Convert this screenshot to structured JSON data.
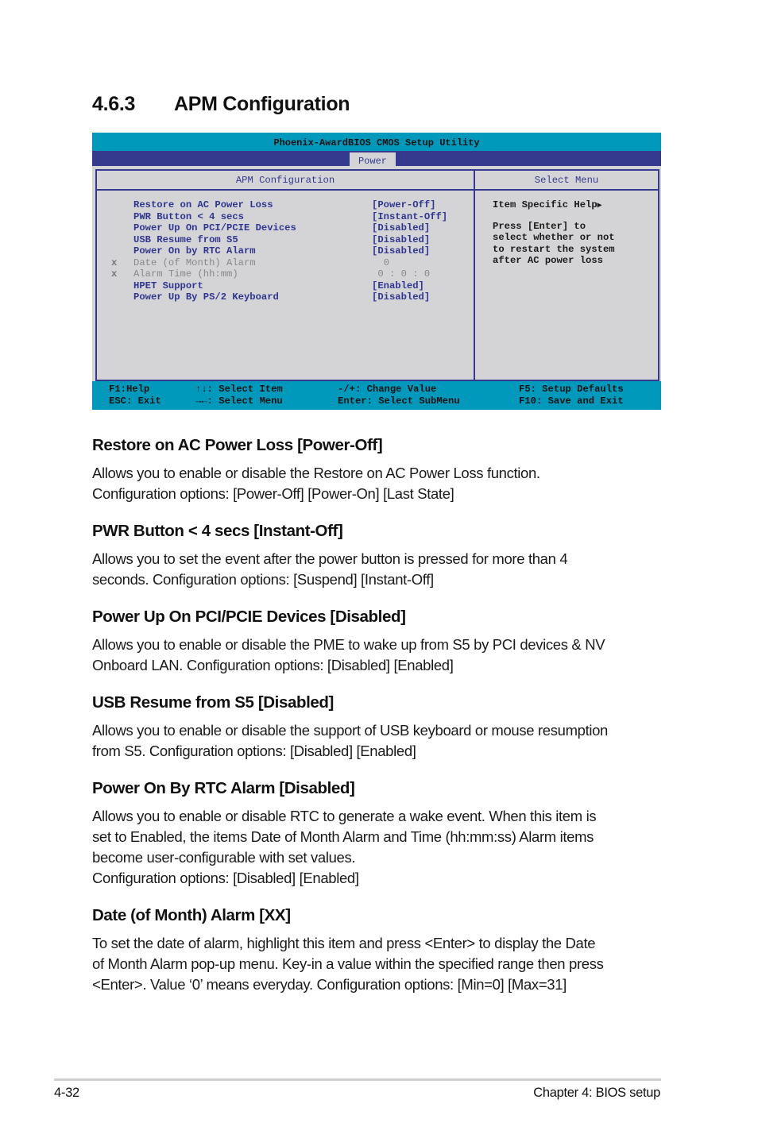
{
  "section": {
    "number": "4.6.3",
    "title": "APM Configuration"
  },
  "bios": {
    "title": "Phoenix-AwardBIOS CMOS Setup Utility",
    "active_tab": "Power",
    "left_header": "APM Configuration",
    "right_header": "Select Menu",
    "items": [
      {
        "mark": "",
        "label": "Restore on AC Power Loss",
        "value": "[Power-Off]",
        "disabled": false
      },
      {
        "mark": "",
        "label": "PWR Button < 4 secs",
        "value": "[Instant-Off]",
        "disabled": false
      },
      {
        "mark": "",
        "label": "Power Up On PCI/PCIE Devices",
        "value": "[Disabled]",
        "disabled": false
      },
      {
        "mark": "",
        "label": "USB Resume from S5",
        "value": "[Disabled]",
        "disabled": false
      },
      {
        "mark": "",
        "label": "Power On by RTC Alarm",
        "value": "[Disabled]",
        "disabled": false
      },
      {
        "mark": "x",
        "label": "Date (of Month) Alarm",
        "value": "  0",
        "disabled": true
      },
      {
        "mark": "x",
        "label": "Alarm Time (hh:mm)",
        "value": " 0 : 0 : 0",
        "disabled": true
      },
      {
        "mark": "",
        "label": "HPET Support",
        "value": "[Enabled]",
        "disabled": false
      },
      {
        "mark": "",
        "label": "Power Up By PS/2 Keyboard",
        "value": "[Disabled]",
        "disabled": false
      }
    ],
    "help": {
      "title": "Item Specific Help",
      "arrow_icon": "right-triangle",
      "lines": [
        "Press [Enter] to",
        "select whether or not",
        "to restart the system",
        "after AC power loss"
      ]
    },
    "footer_keys": [
      [
        "F1:Help",
        "ESC: Exit"
      ],
      [
        "↑↓: Select Item",
        "→←: Select Menu"
      ],
      [
        "-/+: Change Value",
        "Enter: Select SubMenu"
      ],
      [
        "F5: Setup Defaults",
        "F10: Save and Exit"
      ]
    ]
  },
  "descriptions": [
    {
      "heading": "Restore on AC Power Loss [Power-Off]",
      "lines": [
        "Allows you to enable or disable the Restore on AC Power Loss function.",
        "Configuration options: [Power-Off] [Power-On] [Last State]"
      ]
    },
    {
      "heading": "PWR Button < 4 secs [Instant-Off]",
      "lines": [
        "Allows you to set the event after the power button is pressed for more than 4",
        "seconds. Configuration options: [Suspend] [Instant-Off]"
      ]
    },
    {
      "heading": "Power Up On PCI/PCIE Devices [Disabled]",
      "lines": [
        "Allows you to enable or disable the PME to wake up from S5 by PCI devices & NV",
        "Onboard LAN. Configuration options: [Disabled] [Enabled]"
      ]
    },
    {
      "heading": "USB Resume from S5 [Disabled]",
      "lines": [
        "Allows you to enable or disable the support of USB keyboard or mouse resumption",
        "from S5. Configuration options: [Disabled] [Enabled]"
      ]
    },
    {
      "heading": "Power On By RTC Alarm [Disabled]",
      "lines": [
        "Allows you to enable or disable RTC to generate a wake event. When this item is",
        "set to Enabled, the items Date of Month Alarm and Time (hh:mm:ss) Alarm items",
        "become user-configurable with set values.",
        "Configuration options: [Disabled] [Enabled]"
      ]
    },
    {
      "heading": "Date (of Month) Alarm [XX]",
      "lines": [
        "To set the date of alarm, highlight this item and press <Enter> to display the Date",
        "of Month Alarm pop-up menu. Key-in a value within the specified range then press",
        "<Enter>. Value ‘0’ means everyday. Configuration options: [Min=0] [Max=31]"
      ]
    }
  ],
  "footer": {
    "page": "4-32",
    "chapter": "Chapter 4: BIOS setup"
  }
}
